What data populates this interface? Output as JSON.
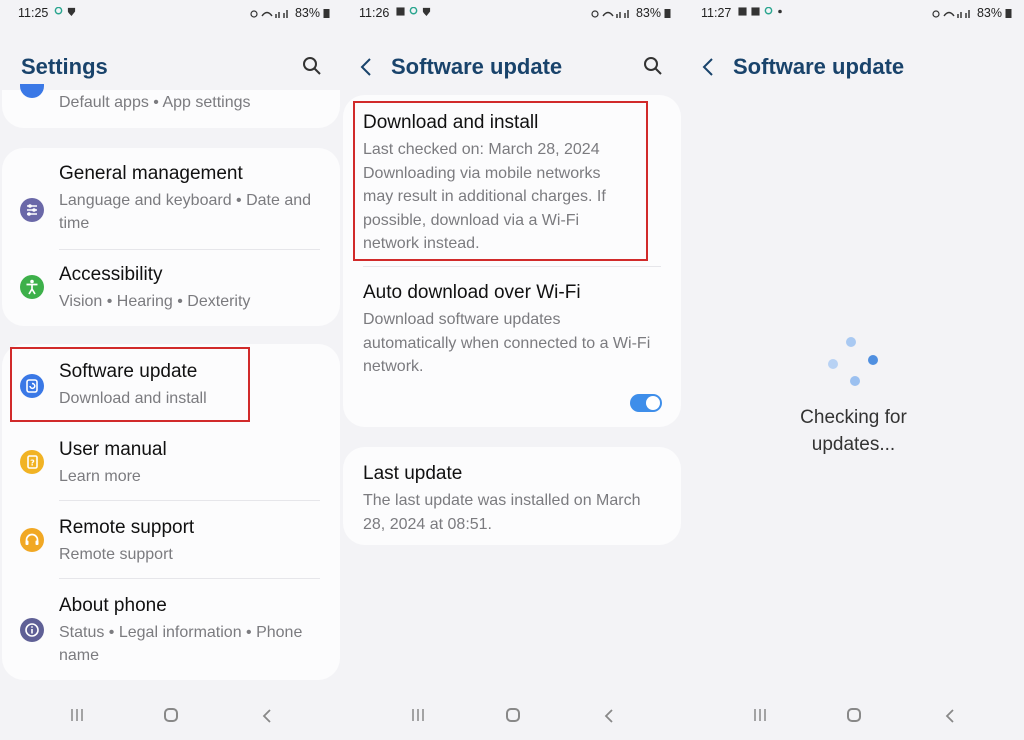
{
  "panel1": {
    "status": {
      "time": "11:25",
      "battery": "83%"
    },
    "title": "Settings",
    "top_partial": {
      "subtitle": "Default apps  •  App settings"
    },
    "items": [
      {
        "title": "General management",
        "subtitle": "Language and keyboard  •  Date and time",
        "icon": "sliders-icon",
        "color": "#6a68a8"
      },
      {
        "title": "Accessibility",
        "subtitle": "Vision  •  Hearing  •  Dexterity",
        "icon": "accessibility-icon",
        "color": "#3db04a"
      },
      {
        "title": "Software update",
        "subtitle": "Download and install",
        "icon": "software-update-icon",
        "color": "#3a78e6"
      },
      {
        "title": "User manual",
        "subtitle": "Learn more",
        "icon": "manual-icon",
        "color": "#f1b324"
      },
      {
        "title": "Remote support",
        "subtitle": "Remote support",
        "icon": "headset-icon",
        "color": "#f1a824"
      },
      {
        "title": "About phone",
        "subtitle": "Status  •  Legal information  •  Phone name",
        "icon": "info-icon",
        "color": "#5f6096"
      }
    ]
  },
  "panel2": {
    "status": {
      "time": "11:26",
      "battery": "83%"
    },
    "title": "Software update",
    "download": {
      "title": "Download and install",
      "last_checked": "Last checked on: March 28, 2024",
      "note": "Downloading via mobile networks may result in additional charges. If possible, download via a Wi-Fi network instead."
    },
    "auto": {
      "title": "Auto download over Wi-Fi",
      "description": "Download software updates automatically when connected to a Wi-Fi network.",
      "enabled": true
    },
    "last_update": {
      "title": "Last update",
      "description": "The last update was installed on March 28, 2024 at 08:51."
    }
  },
  "panel3": {
    "status": {
      "time": "11:27",
      "battery": "83%"
    },
    "title": "Software update",
    "checking": "Checking for updates..."
  },
  "colors": {
    "accent": "#3e8eea",
    "title": "#19436b",
    "highlight": "#d12a2a",
    "spinner": "#7fb0ec"
  }
}
